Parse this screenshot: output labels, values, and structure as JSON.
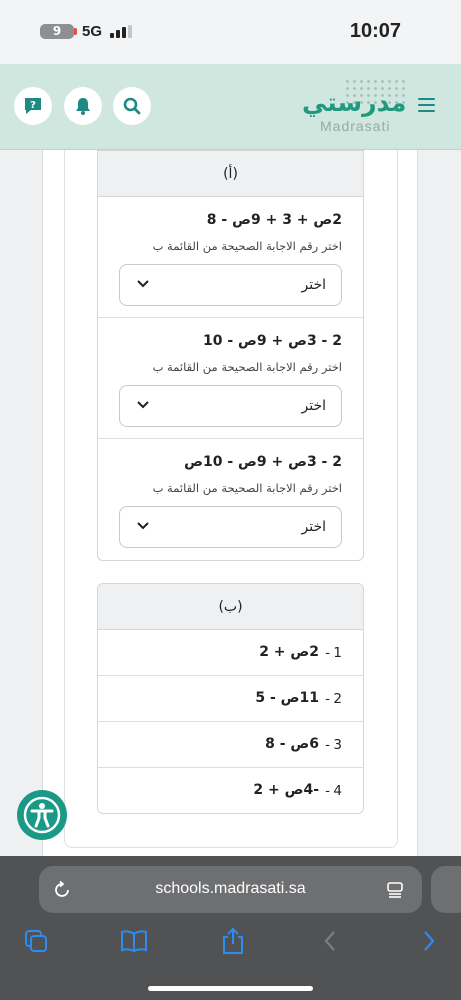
{
  "status_bar": {
    "battery": "9",
    "network": "5G",
    "time": "10:07"
  },
  "header": {
    "logo_ar": "مدرستي",
    "logo_en": "Madrasati"
  },
  "panel_a": {
    "title": "(أ)",
    "questions": [
      {
        "expr": "2ص + 3 + 9ص - 8",
        "hint": "اختر رقم الاجابة الصحيحة من القائمة ب",
        "select": "اختر"
      },
      {
        "expr": "2 - 3ص + 9ص - 10",
        "hint": "اختر رقم الاجابة الصحيحة من القائمة ب",
        "select": "اختر"
      },
      {
        "expr": "2 - 3ص + 9ص - 10ص",
        "hint": "اختر رقم الاجابة الصحيحة من القائمة ب",
        "select": "اختر"
      }
    ]
  },
  "panel_b": {
    "title": "(ب)",
    "items": [
      {
        "num": "1",
        "expr": "2ص + 2"
      },
      {
        "num": "2",
        "expr": "11ص - 5"
      },
      {
        "num": "3",
        "expr": "6ص - 8"
      },
      {
        "num": "4",
        "expr": "-4ص + 2"
      }
    ]
  },
  "browser": {
    "url": "schools.madrasati.sa"
  },
  "colors": {
    "brand": "#1f9a7e",
    "header_bg": "#cfe7df",
    "icon_teal": "#1f8a84",
    "toolbar_blue": "#2d8cf0"
  }
}
